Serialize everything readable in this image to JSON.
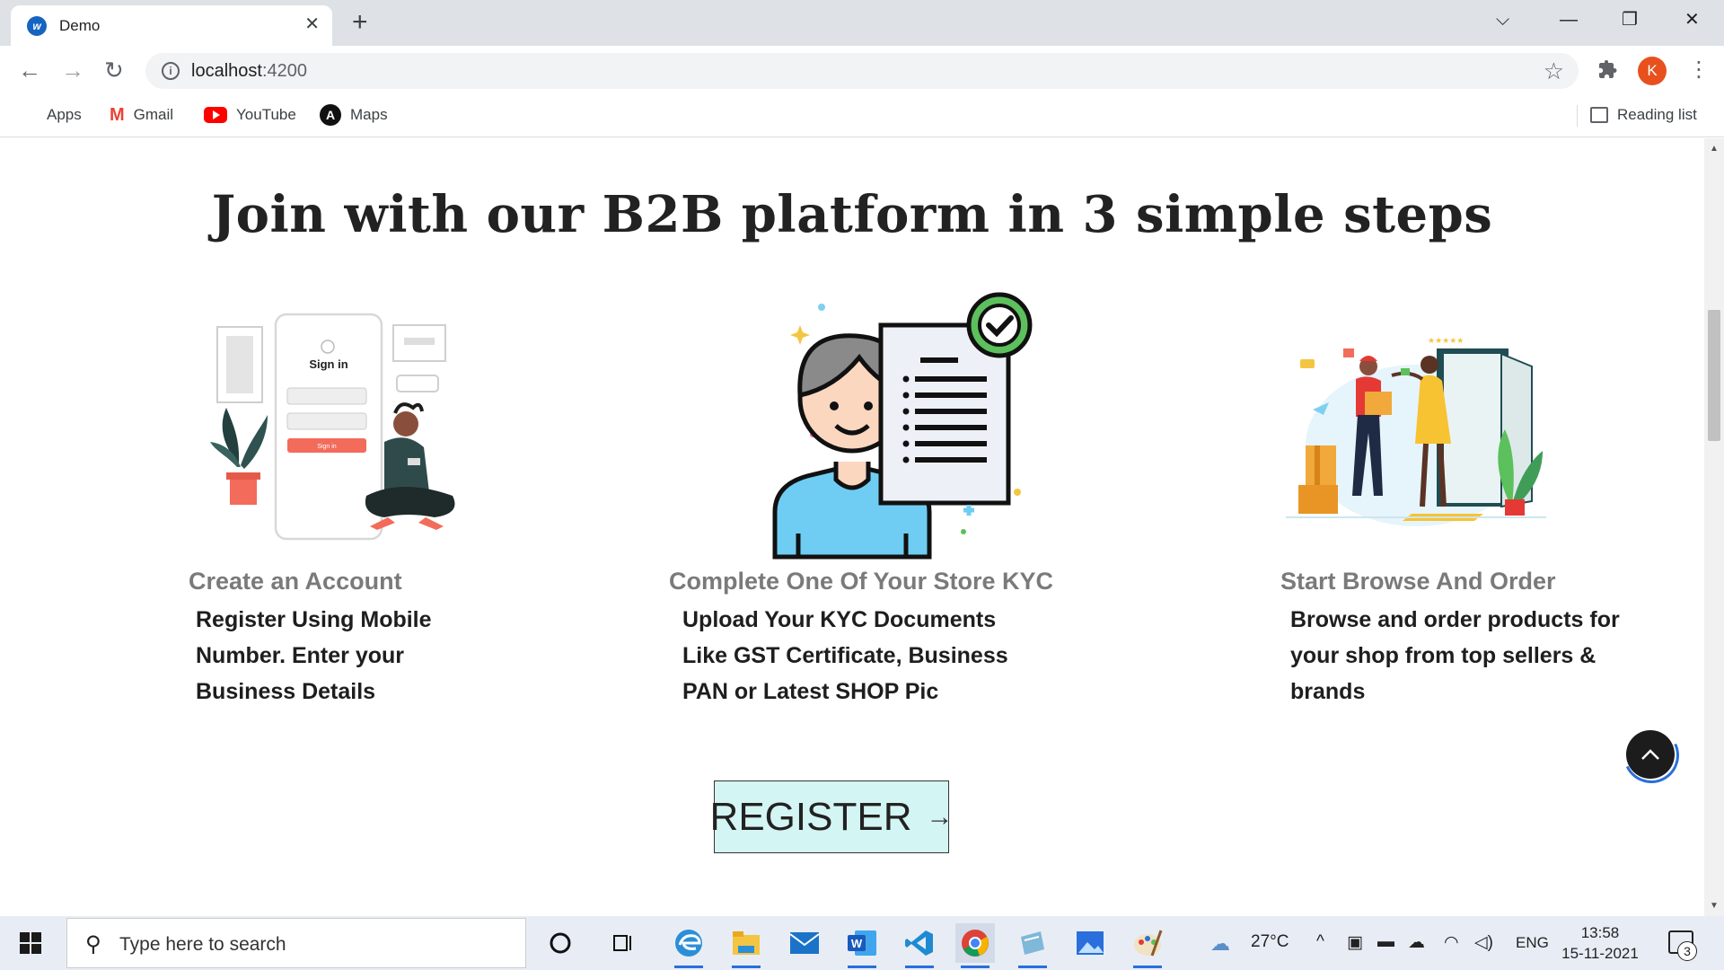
{
  "browser": {
    "tab_title": "Demo",
    "tab_close": "✕",
    "new_tab": "+",
    "url_host": "localhost",
    "url_port": ":4200",
    "window_controls": {
      "dropdown": "⌵",
      "minimize": "—",
      "restore": "❐",
      "close": "✕"
    },
    "profile_initial": "K",
    "bookmarks": [
      {
        "label": "Apps",
        "icon": "apps-grid-icon"
      },
      {
        "label": "Gmail",
        "icon": "gmail-icon"
      },
      {
        "label": "YouTube",
        "icon": "youtube-icon"
      },
      {
        "label": "Maps",
        "icon": "maps-icon"
      }
    ],
    "reading_list": "Reading list"
  },
  "page": {
    "heading": "Join with our B2B platform in 3 simple steps",
    "steps": [
      {
        "title": "Create an Account",
        "lines": [
          "Register Using Mobile",
          "Number. Enter your",
          "Business Details"
        ],
        "illustration": "sign-in-illustration",
        "illus_text": {
          "signin": "Sign in",
          "button": "Sign in"
        }
      },
      {
        "title": "Complete One Of Your Store KYC",
        "lines": [
          "Upload Your KYC Documents",
          "Like GST Certificate, Business",
          "PAN or Latest SHOP Pic"
        ],
        "illustration": "kyc-document-illustration"
      },
      {
        "title": "Start Browse And Order",
        "lines": [
          "Browse and order products for",
          "your shop from top sellers &",
          "brands"
        ],
        "illustration": "delivery-illustration"
      }
    ],
    "register_label": "REGISTER",
    "register_arrow": "→"
  },
  "taskbar": {
    "search_placeholder": "Type here to search",
    "weather": "27°C",
    "language": "ENG",
    "time": "13:58",
    "date": "15-11-2021",
    "notification_count": "3"
  },
  "colors": {
    "register_bg": "#d3f5f3",
    "step_title": "#7a7a7a",
    "avatar": "#e8501e"
  }
}
